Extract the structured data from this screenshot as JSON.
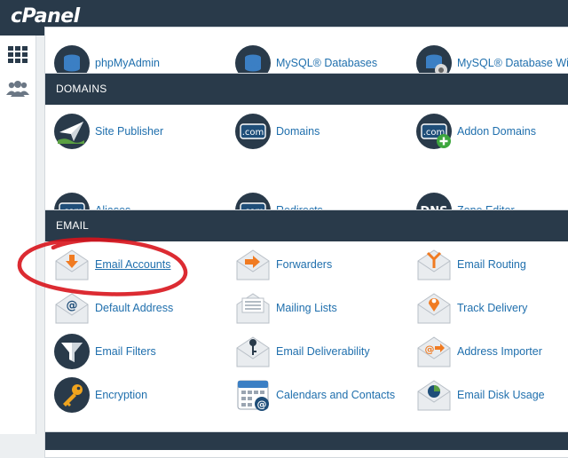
{
  "brand": "cPanel",
  "colors": {
    "header": "#293a4a",
    "link": "#1f6fad",
    "annotation": "#d8141c"
  },
  "sidebar": {
    "items": [
      {
        "icon": "grid-icon"
      },
      {
        "icon": "users-icon"
      }
    ]
  },
  "top_partial": {
    "items": [
      {
        "label": "phpMyAdmin"
      },
      {
        "label": "MySQL® Databases"
      },
      {
        "label": "MySQL® Database Wiz"
      }
    ]
  },
  "domains": {
    "title": "DOMAINS",
    "items": [
      {
        "label": "Site Publisher",
        "icon": "paper-plane-icon"
      },
      {
        "label": "Domains",
        "icon": "dotcom-icon"
      },
      {
        "label": "Addon Domains",
        "icon": "dotcom-plus-icon"
      },
      {
        "label": "Aliases",
        "icon": "dotcom-equal-icon"
      },
      {
        "label": "Redirects",
        "icon": "dotcom-redirect-icon"
      },
      {
        "label": "Zone Editor",
        "icon": "dns-icon"
      }
    ]
  },
  "email": {
    "title": "EMAIL",
    "items": [
      {
        "label": "Email Accounts",
        "icon": "envelope-down-arrow-icon"
      },
      {
        "label": "Forwarders",
        "icon": "envelope-right-arrow-icon"
      },
      {
        "label": "Email Routing",
        "icon": "envelope-routing-icon"
      },
      {
        "label": "Default Address",
        "icon": "envelope-at-icon"
      },
      {
        "label": "Mailing Lists",
        "icon": "envelope-list-icon"
      },
      {
        "label": "Track Delivery",
        "icon": "envelope-pin-icon"
      },
      {
        "label": "Email Filters",
        "icon": "funnel-icon"
      },
      {
        "label": "Email Deliverability",
        "icon": "envelope-key-icon"
      },
      {
        "label": "Address Importer",
        "icon": "envelope-import-icon"
      },
      {
        "label": "Encryption",
        "icon": "key-icon"
      },
      {
        "label": "Calendars and Contacts",
        "icon": "calendar-icon"
      },
      {
        "label": "Email Disk Usage",
        "icon": "envelope-pie-icon"
      }
    ]
  }
}
